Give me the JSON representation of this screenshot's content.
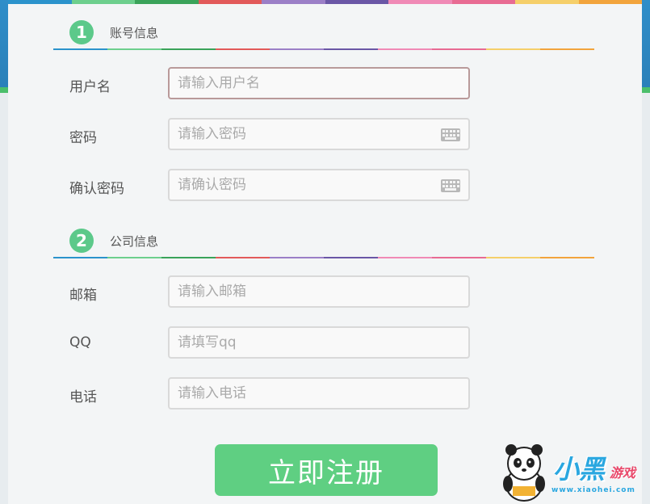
{
  "colors": {
    "stripes": [
      "#2b93cc",
      "#6dcf8d",
      "#3aa35a",
      "#e25a5a",
      "#9b7fc7",
      "#6a57a6",
      "#f08ab6",
      "#e86b93",
      "#f5cf6a",
      "#f2a43c"
    ],
    "accent_green": "#5fcf82",
    "badge_green": "#5cc98a"
  },
  "sections": [
    {
      "number": "1",
      "title": "账号信息",
      "fields": [
        {
          "label": "用户名",
          "placeholder": "请输入用户名",
          "value": "",
          "keyboard_icon": false
        },
        {
          "label": "密码",
          "placeholder": "请输入密码",
          "value": "",
          "keyboard_icon": true
        },
        {
          "label": "确认密码",
          "placeholder": "请确认密码",
          "value": "",
          "keyboard_icon": true
        }
      ]
    },
    {
      "number": "2",
      "title": "公司信息",
      "fields": [
        {
          "label": "邮箱",
          "placeholder": "请输入邮箱",
          "value": "",
          "keyboard_icon": false
        },
        {
          "label": "QQ",
          "placeholder": "请填写qq",
          "value": "",
          "keyboard_icon": false
        },
        {
          "label": "电话",
          "placeholder": "请输入电话",
          "value": "",
          "keyboard_icon": false
        }
      ]
    }
  ],
  "submit_label": "立即注册",
  "watermark": {
    "brand": "小黑",
    "brand_sub": "游戏",
    "url": "www.xiaohei.com"
  }
}
